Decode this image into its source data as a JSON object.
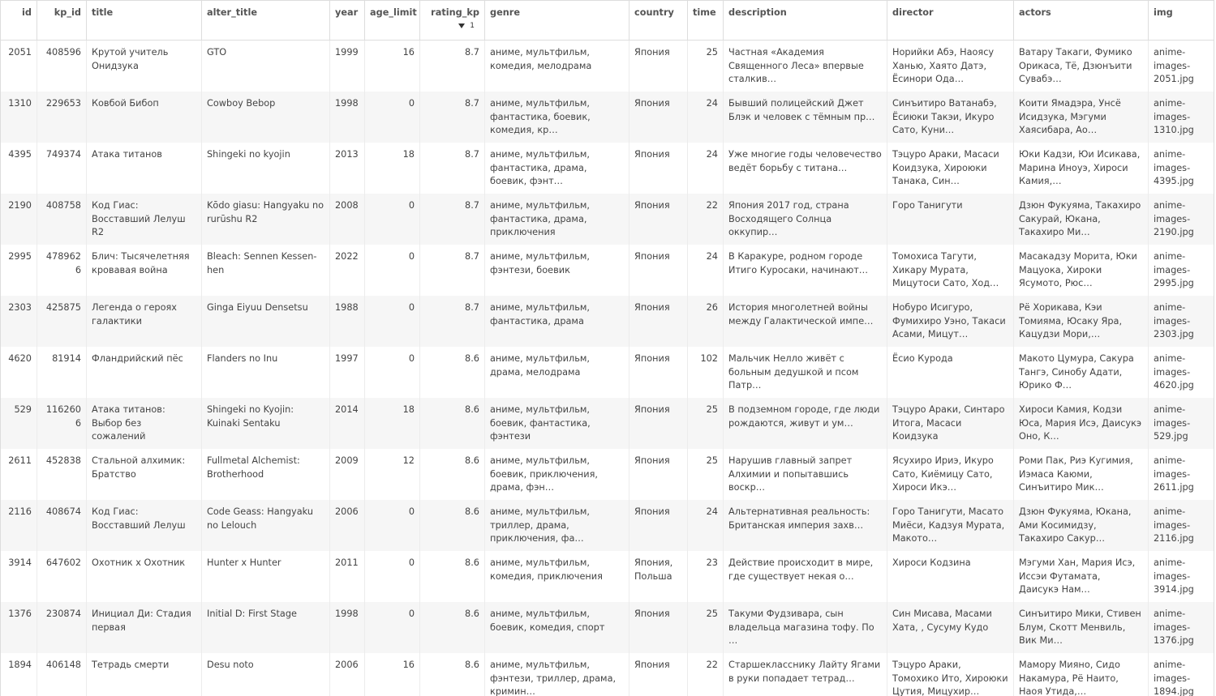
{
  "columns": {
    "id": "id",
    "kp_id": "kp_id",
    "title": "title",
    "alter_title": "alter_title",
    "year": "year",
    "age_limit": "age_limit",
    "rating_kp": "rating_kp",
    "sort_index": "1",
    "genre": "genre",
    "country": "country",
    "time": "time",
    "description": "description",
    "director": "director",
    "actors": "actors",
    "img": "img"
  },
  "rows": [
    {
      "id": "2051",
      "kp_id": "408596",
      "title": "Крутой учитель Онидзука",
      "alter_title": "GTO",
      "year": "1999",
      "age_limit": "16",
      "rating_kp": "8.7",
      "genre": "аниме, мультфильм, комедия, мелодрама",
      "country": "Япония",
      "time": "25",
      "description": "Частная «Академия Священного Леса» впервые сталкив…",
      "director": "Норийки Абэ, Наоясу Ханью, Хаято Датэ, Ёсинори Ода…",
      "actors": "Ватару Такаги, Фумико Орикаса, Тё, Дзюнъити Сувабэ…",
      "img": "anime-images-2051.jpg"
    },
    {
      "id": "1310",
      "kp_id": "229653",
      "title": "Ковбой Бибоп",
      "alter_title": "Cowboy Bebop",
      "year": "1998",
      "age_limit": "0",
      "rating_kp": "8.7",
      "genre": "аниме, мультфильм, фантастика, боевик, комедия, кр…",
      "country": "Япония",
      "time": "24",
      "description": "Бывший полицейский Джет Блэк и человек с тёмным пр…",
      "director": "Синъитиро Ватанабэ, Ёсиюки Такэи, Икуро Сато, Куни…",
      "actors": "Коити Ямадэра, Унсё Исидзука, Мэгуми Хаясибара, Ао…",
      "img": "anime-images-1310.jpg"
    },
    {
      "id": "4395",
      "kp_id": "749374",
      "title": "Атака титанов",
      "alter_title": "Shingeki no kyojin",
      "year": "2013",
      "age_limit": "18",
      "rating_kp": "8.7",
      "genre": "аниме, мультфильм, фантастика, драма, боевик, фэнт…",
      "country": "Япония",
      "time": "24",
      "description": "Уже многие годы человечество ведёт борьбу с титана…",
      "director": "Тэцуро Араки, Масаси Коидзука, Хироюки Танака, Син…",
      "actors": "Юки Кадзи, Юи Исикава, Марина Иноуэ, Хироси Камия,…",
      "img": "anime-images-4395.jpg"
    },
    {
      "id": "2190",
      "kp_id": "408758",
      "title": "Код Гиас: Восставший Лелуш R2",
      "alter_title": "Kōdo giasu: Hangyaku no rurūshu R2",
      "year": "2008",
      "age_limit": "0",
      "rating_kp": "8.7",
      "genre": "аниме, мультфильм, фантастика, драма, приключения",
      "country": "Япония",
      "time": "22",
      "description": "Япония 2017 год, страна Восходящего Солнца оккупир…",
      "director": "Горо Танигути",
      "actors": "Дзюн Фукуяма, Такахиро Сакурай, Юкана, Такахиро Ми…",
      "img": "anime-images-2190.jpg"
    },
    {
      "id": "2995",
      "kp_id": "4789626",
      "title": "Блич: Тысячелетняя кровавая война",
      "alter_title": "Bleach: Sennen Kessen-hen",
      "year": "2022",
      "age_limit": "0",
      "rating_kp": "8.7",
      "genre": "аниме, мультфильм, фэнтези, боевик",
      "country": "Япония",
      "time": "24",
      "description": "В Каракуре, родном городе Итиго Куросаки, начинают…",
      "director": "Томохиса Тагути, Хикару Мурата, Мицутоси Сато, Ход…",
      "actors": "Масакадзу Морита, Юки Мацуока, Хироки Ясумото, Рюс…",
      "img": "anime-images-2995.jpg"
    },
    {
      "id": "2303",
      "kp_id": "425875",
      "title": "Легенда о героях галактики",
      "alter_title": "Ginga Eiyuu Densetsu",
      "year": "1988",
      "age_limit": "0",
      "rating_kp": "8.7",
      "genre": "аниме, мультфильм, фантастика, драма",
      "country": "Япония",
      "time": "26",
      "description": "История многолетней войны между Галактической импе…",
      "director": "Нобуро Исигуро, Фумихиро Уэно, Такаси Асами, Мицут…",
      "actors": "Рё Хорикава, Кэи Томияма, Юсаку Яра, Кацудзи Мори,…",
      "img": "anime-images-2303.jpg"
    },
    {
      "id": "4620",
      "kp_id": "81914",
      "title": "Фландрийский пёс",
      "alter_title": "Flanders no Inu",
      "year": "1997",
      "age_limit": "0",
      "rating_kp": "8.6",
      "genre": "аниме, мультфильм, драма, мелодрама",
      "country": "Япония",
      "time": "102",
      "description": "Мальчик Нелло живёт с больным дедушкой и псом Патр…",
      "director": "Ёсио Курода",
      "actors": "Макото Цумура, Сакура Тангэ, Синобу Адати, Юрико Ф…",
      "img": "anime-images-4620.jpg"
    },
    {
      "id": "529",
      "kp_id": "1162606",
      "title": "Атака титанов: Выбор без сожалений",
      "alter_title": "Shingeki no Kyojin: Kuinaki Sentaku",
      "year": "2014",
      "age_limit": "18",
      "rating_kp": "8.6",
      "genre": "аниме, мультфильм, боевик, фантастика, фэнтези",
      "country": "Япония",
      "time": "25",
      "description": "В подземном городе, где люди рождаются, живут и ум…",
      "director": "Тэцуро Араки, Синтаро Итога, Масаси Коидзука",
      "actors": "Хироси Камия, Кодзи Юса, Мария Исэ, Даисукэ Оно, К…",
      "img": "anime-images-529.jpg"
    },
    {
      "id": "2611",
      "kp_id": "452838",
      "title": "Стальной алхимик: Братство",
      "alter_title": "Fullmetal Alchemist: Brotherhood",
      "year": "2009",
      "age_limit": "12",
      "rating_kp": "8.6",
      "genre": "аниме, мультфильм, боевик, приключения, драма, фэн…",
      "country": "Япония",
      "time": "25",
      "description": "Нарушив главный запрет Алхимии и попытавшись воскр…",
      "director": "Ясухиро Ириэ, Икуро Сато, Киёмицу Сато, Хироси Икэ…",
      "actors": "Роми Пак, Риэ Кугимия, Иэмаса Каюми, Синъитиро Мик…",
      "img": "anime-images-2611.jpg"
    },
    {
      "id": "2116",
      "kp_id": "408674",
      "title": "Код Гиас: Восставший Лелуш",
      "alter_title": "Code Geass: Hangyaku no Lelouch",
      "year": "2006",
      "age_limit": "0",
      "rating_kp": "8.6",
      "genre": "аниме, мультфильм, триллер, драма, приключения, фа…",
      "country": "Япония",
      "time": "24",
      "description": "Альтернативная реальность: Британская империя захв…",
      "director": "Горо Танигути, Масато Миёси, Кадзуя Мурата, Макото…",
      "actors": "Дзюн Фукуяма, Юкана, Ами Косимидзу, Такахиро Сакур…",
      "img": "anime-images-2116.jpg"
    },
    {
      "id": "3914",
      "kp_id": "647602",
      "title": "Охотник х Охотник",
      "alter_title": "Hunter x Hunter",
      "year": "2011",
      "age_limit": "0",
      "rating_kp": "8.6",
      "genre": "аниме, мультфильм, комедия, приключения",
      "country": "Япония, Польша",
      "time": "23",
      "description": "Действие происходит в мире, где существует некая о…",
      "director": "Хироси Кодзина",
      "actors": "Мэгуми Хан, Мария Исэ, Иссэи Футамата, Даисукэ Нам…",
      "img": "anime-images-3914.jpg"
    },
    {
      "id": "1376",
      "kp_id": "230874",
      "title": "Инициал Ди: Стадия первая",
      "alter_title": "Initial D: First Stage",
      "year": "1998",
      "age_limit": "0",
      "rating_kp": "8.6",
      "genre": "аниме, мультфильм, боевик, комедия, спорт",
      "country": "Япония",
      "time": "25",
      "description": "Такуми Фудзивара, сын владельца магазина тофу. По …",
      "director": "Син Мисава, Масами Хата, , Сусуму Кудо",
      "actors": "Синъитиро Мики, Стивен Блум, Скотт Менвиль, Вик Ми…",
      "img": "anime-images-1376.jpg"
    },
    {
      "id": "1894",
      "kp_id": "406148",
      "title": "Тетрадь смерти",
      "alter_title": "Desu noto",
      "year": "2006",
      "age_limit": "16",
      "rating_kp": "8.6",
      "genre": "аниме, мультфильм, фэнтези, триллер, драма, кримин…",
      "country": "Япония",
      "time": "22",
      "description": "Старшекласснику Лайту Ягами в руки попадает тетрад…",
      "director": "Тэцуро Араки, Томохико Ито, Хироюки Цутия, Мицухир…",
      "actors": "Мамору Мияно, Сидо Накамура, Рё Наито, Наоя Утида,…",
      "img": "anime-images-1894.jpg"
    }
  ]
}
